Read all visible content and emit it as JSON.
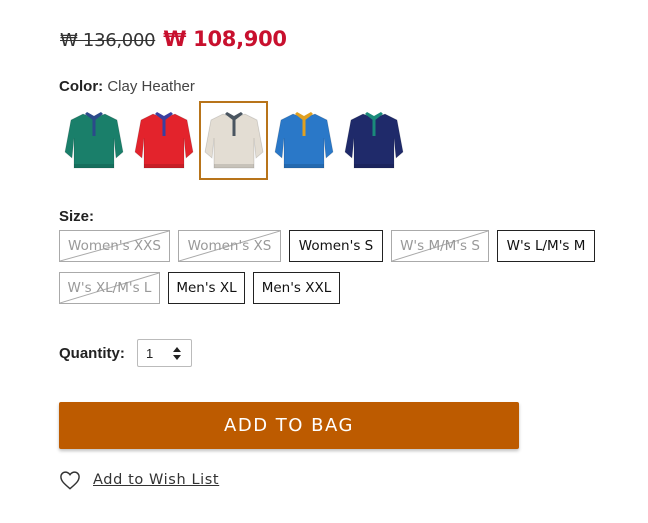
{
  "price": {
    "original": "₩ 136,000",
    "sale": "₩ 108,900"
  },
  "color": {
    "label": "Color:",
    "selected_name": "Clay Heather",
    "swatches": [
      {
        "color": "#1a7f6a",
        "accent": "#2b4a8a",
        "selected": false
      },
      {
        "color": "#e3232c",
        "accent": "#3a3fa0",
        "selected": false
      },
      {
        "color": "#e3ddd3",
        "accent": "#4a5560",
        "selected": true
      },
      {
        "color": "#2a78c8",
        "accent": "#e0a020",
        "selected": false
      },
      {
        "color": "#1f2a6a",
        "accent": "#1a8a7a",
        "selected": false
      }
    ]
  },
  "size": {
    "label": "Size:",
    "options": [
      {
        "label": "Women's XXS",
        "available": false
      },
      {
        "label": "Women's XS",
        "available": false
      },
      {
        "label": "Women's S",
        "available": true
      },
      {
        "label": "W's M/M's S",
        "available": false
      },
      {
        "label": "W's L/M's M",
        "available": true
      },
      {
        "label": "W's XL/M's L",
        "available": false
      },
      {
        "label": "Men's XL",
        "available": true
      },
      {
        "label": "Men's XXL",
        "available": true
      }
    ]
  },
  "quantity": {
    "label": "Quantity:",
    "value": "1"
  },
  "add_to_bag": "ADD TO BAG",
  "wishlist": "Add to Wish List",
  "colors": {
    "sale": "#c8102e",
    "button": "#bd5b00",
    "selected_border": "#b8741a"
  }
}
